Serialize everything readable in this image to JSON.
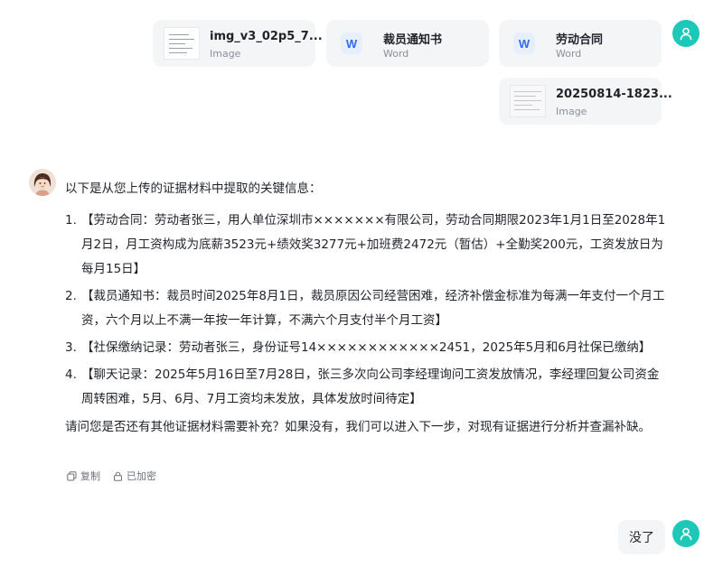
{
  "attachments": [
    {
      "name": "img_v3_02p5_7...",
      "type": "Image"
    },
    {
      "name": "裁员通知书",
      "type": "Word",
      "badge": "W"
    },
    {
      "name": "劳动合同",
      "type": "Word",
      "badge": "W"
    },
    {
      "name": "20250814-1823...",
      "type": "Image"
    }
  ],
  "assistant": {
    "intro": "以下是从您上传的证据材料中提取的关键信息：",
    "items": [
      {
        "num": "1.",
        "text": "【劳动合同：劳动者张三，用人单位深圳市×××××××有限公司，劳动合同期限2023年1月1日至2028年1月2日，月工资构成为底薪3523元+绩效奖3277元+加班费2472元（暂估）+全勤奖200元，工资发放日为每月15日】"
      },
      {
        "num": "2.",
        "text": "【裁员通知书：裁员时间2025年8月1日，裁员原因公司经营困难，经济补偿金标准为每满一年支付一个月工资，六个月以上不满一年按一年计算，不满六个月支付半个月工资】"
      },
      {
        "num": "3.",
        "text": "【社保缴纳记录：劳动者张三，身份证号14××××××××××××2451，2025年5月和6月社保已缴纳】"
      },
      {
        "num": "4.",
        "text": "【聊天记录：2025年5月16日至7月28日，张三多次向公司李经理询问工资发放情况，李经理回复公司资金周转困难，5月、6月、7月工资均未发放，具体发放时间待定】"
      }
    ],
    "closing": "请问您是否还有其他证据材料需要补充？如果没有，我们可以进入下一步，对现有证据进行分析并查漏补缺。",
    "actions": {
      "copy": "复制",
      "encrypted": "已加密"
    }
  },
  "user_reply": "没了",
  "colors": {
    "user_avatar": "#1ec8b8",
    "card_bg": "#f4f5f7",
    "word_icon": "#2f6bff"
  }
}
